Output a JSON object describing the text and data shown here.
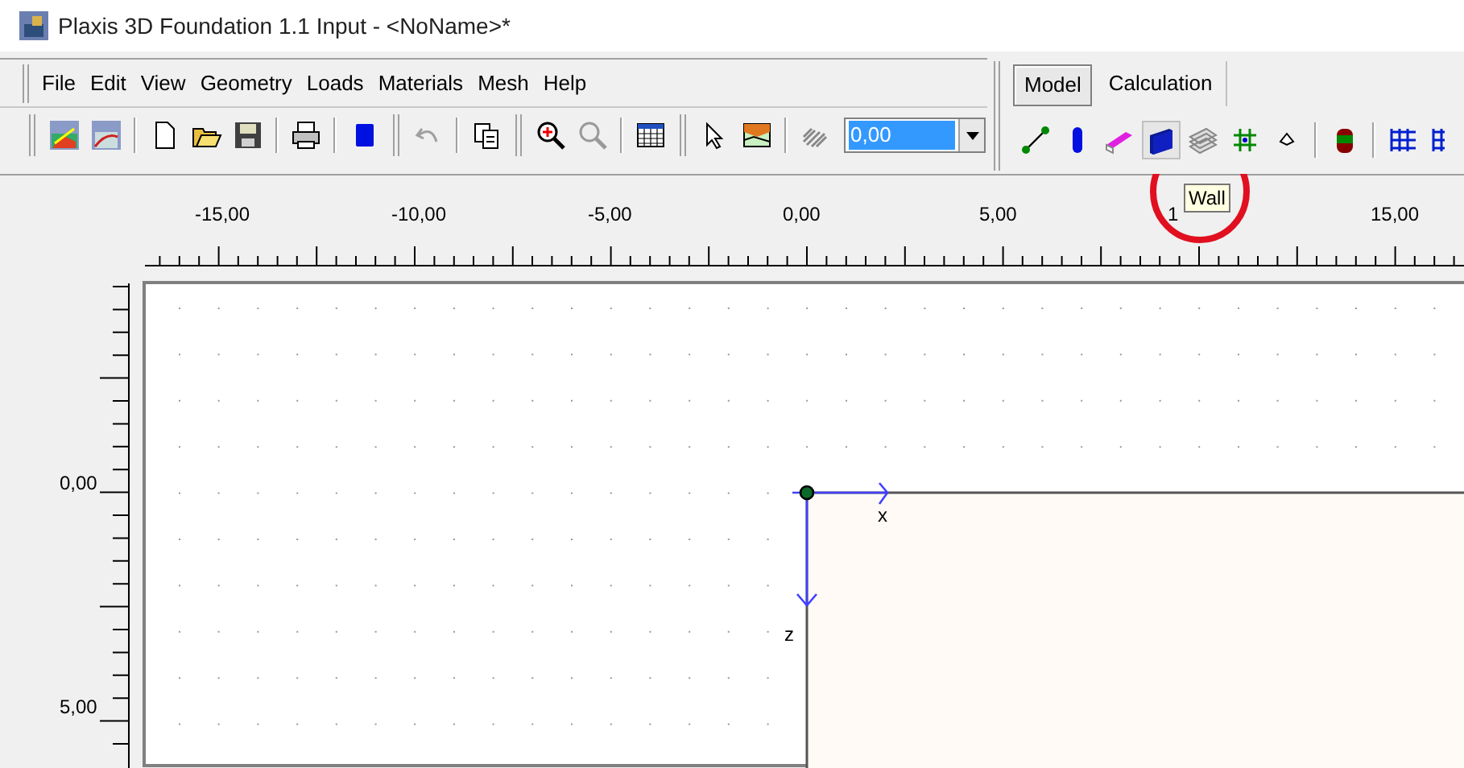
{
  "window": {
    "title": "Plaxis 3D Foundation 1.1 Input - <NoName>*"
  },
  "menu": [
    "File",
    "Edit",
    "View",
    "Geometry",
    "Loads",
    "Materials",
    "Mesh",
    "Help"
  ],
  "mode_tabs": [
    {
      "label": "Model",
      "selected": true
    },
    {
      "label": "Calculation",
      "selected": false
    }
  ],
  "toolbar": {
    "level_combo": {
      "value": "0,00"
    }
  },
  "tooltip": {
    "text": "Wall"
  },
  "ruler_top": {
    "labels": [
      "-15,00",
      "-10,00",
      "-5,00",
      "0,00",
      "5,00",
      "1",
      "15,00"
    ]
  },
  "ruler_left": {
    "labels": [
      "0,00",
      "5,00"
    ]
  },
  "axes": {
    "x_label": "x",
    "z_label": "z"
  }
}
